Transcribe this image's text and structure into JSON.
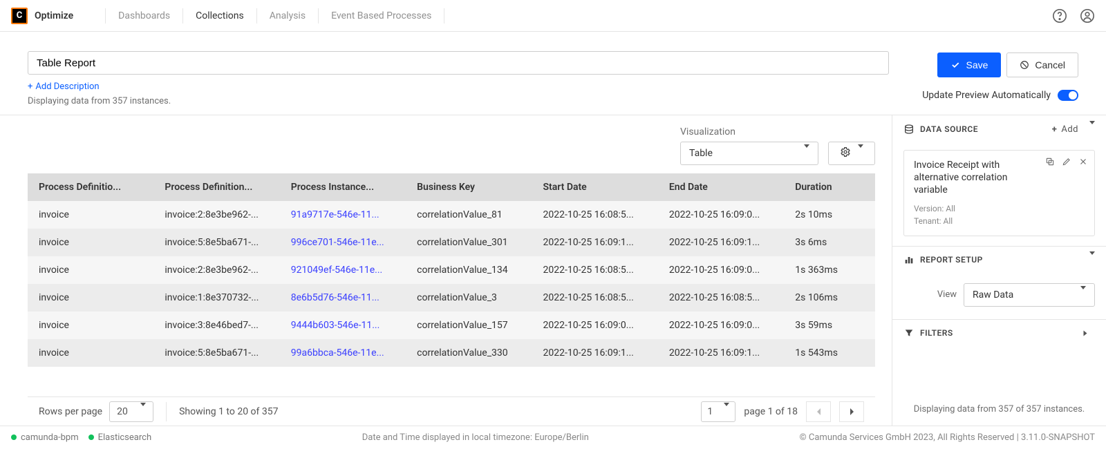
{
  "brand": "Optimize",
  "nav": {
    "dashboards": "Dashboards",
    "collections": "Collections",
    "analysis": "Analysis",
    "ebp": "Event Based Processes"
  },
  "report": {
    "name": "Table Report",
    "add_description": "Add Description",
    "instance_text": "Displaying data from 357 instances."
  },
  "buttons": {
    "save": "Save",
    "cancel": "Cancel"
  },
  "auto_preview_label": "Update Preview Automatically",
  "visualization": {
    "label": "Visualization",
    "value": "Table"
  },
  "table": {
    "headers": {
      "proc_key": "Process Definitio...",
      "proc_id": "Process Definition...",
      "inst_id": "Process Instance...",
      "bkey": "Business Key",
      "start": "Start Date",
      "end": "End Date",
      "duration": "Duration"
    },
    "rows": [
      {
        "k": "invoice",
        "pid": "invoice:2:8e3be962-...",
        "inst": "91a9717e-546e-11...",
        "bk": "correlationValue_81",
        "s": "2022-10-25 16:08:5...",
        "e": "2022-10-25 16:09:0...",
        "d": "2s 10ms"
      },
      {
        "k": "invoice",
        "pid": "invoice:5:8e5ba671-...",
        "inst": "996ce701-546e-11e...",
        "bk": "correlationValue_301",
        "s": "2022-10-25 16:09:1...",
        "e": "2022-10-25 16:09:1...",
        "d": "3s 6ms"
      },
      {
        "k": "invoice",
        "pid": "invoice:2:8e3be962-...",
        "inst": "921049ef-546e-11e...",
        "bk": "correlationValue_134",
        "s": "2022-10-25 16:08:5...",
        "e": "2022-10-25 16:09:0...",
        "d": "1s 363ms"
      },
      {
        "k": "invoice",
        "pid": "invoice:1:8e370732-...",
        "inst": "8e6b5d76-546e-11...",
        "bk": "correlationValue_3",
        "s": "2022-10-25 16:08:5...",
        "e": "2022-10-25 16:08:5...",
        "d": "2s 106ms"
      },
      {
        "k": "invoice",
        "pid": "invoice:3:8e46bed7-...",
        "inst": "9444b603-546e-11...",
        "bk": "correlationValue_157",
        "s": "2022-10-25 16:09:0...",
        "e": "2022-10-25 16:09:0...",
        "d": "3s 59ms"
      },
      {
        "k": "invoice",
        "pid": "invoice:5:8e5ba671-...",
        "inst": "99a6bbca-546e-11e...",
        "bk": "correlationValue_330",
        "s": "2022-10-25 16:09:1...",
        "e": "2022-10-25 16:09:1...",
        "d": "1s 543ms"
      }
    ]
  },
  "pagination": {
    "rows_per_page_label": "Rows per page",
    "rows_per_page": "20",
    "showing": "Showing 1 to 20 of 357",
    "current_page": "1",
    "page_of": "page 1 of 18"
  },
  "side": {
    "data_source_title": "Data Source",
    "add_label": "Add",
    "ds_name": "Invoice Receipt with alternative correlation variable",
    "ds_version": "Version: All",
    "ds_tenant": "Tenant: All",
    "report_setup_title": "Report Setup",
    "view_label": "View",
    "view_value": "Raw Data",
    "filters_title": "Filters",
    "footer": "Displaying data from 357 of 357 instances."
  },
  "footer": {
    "engine": "camunda-bpm",
    "es": "Elasticsearch",
    "tz": "Date and Time displayed in local timezone: Europe/Berlin",
    "copy": "© Camunda Services GmbH 2023, All Rights Reserved | 3.11.0-SNAPSHOT"
  }
}
